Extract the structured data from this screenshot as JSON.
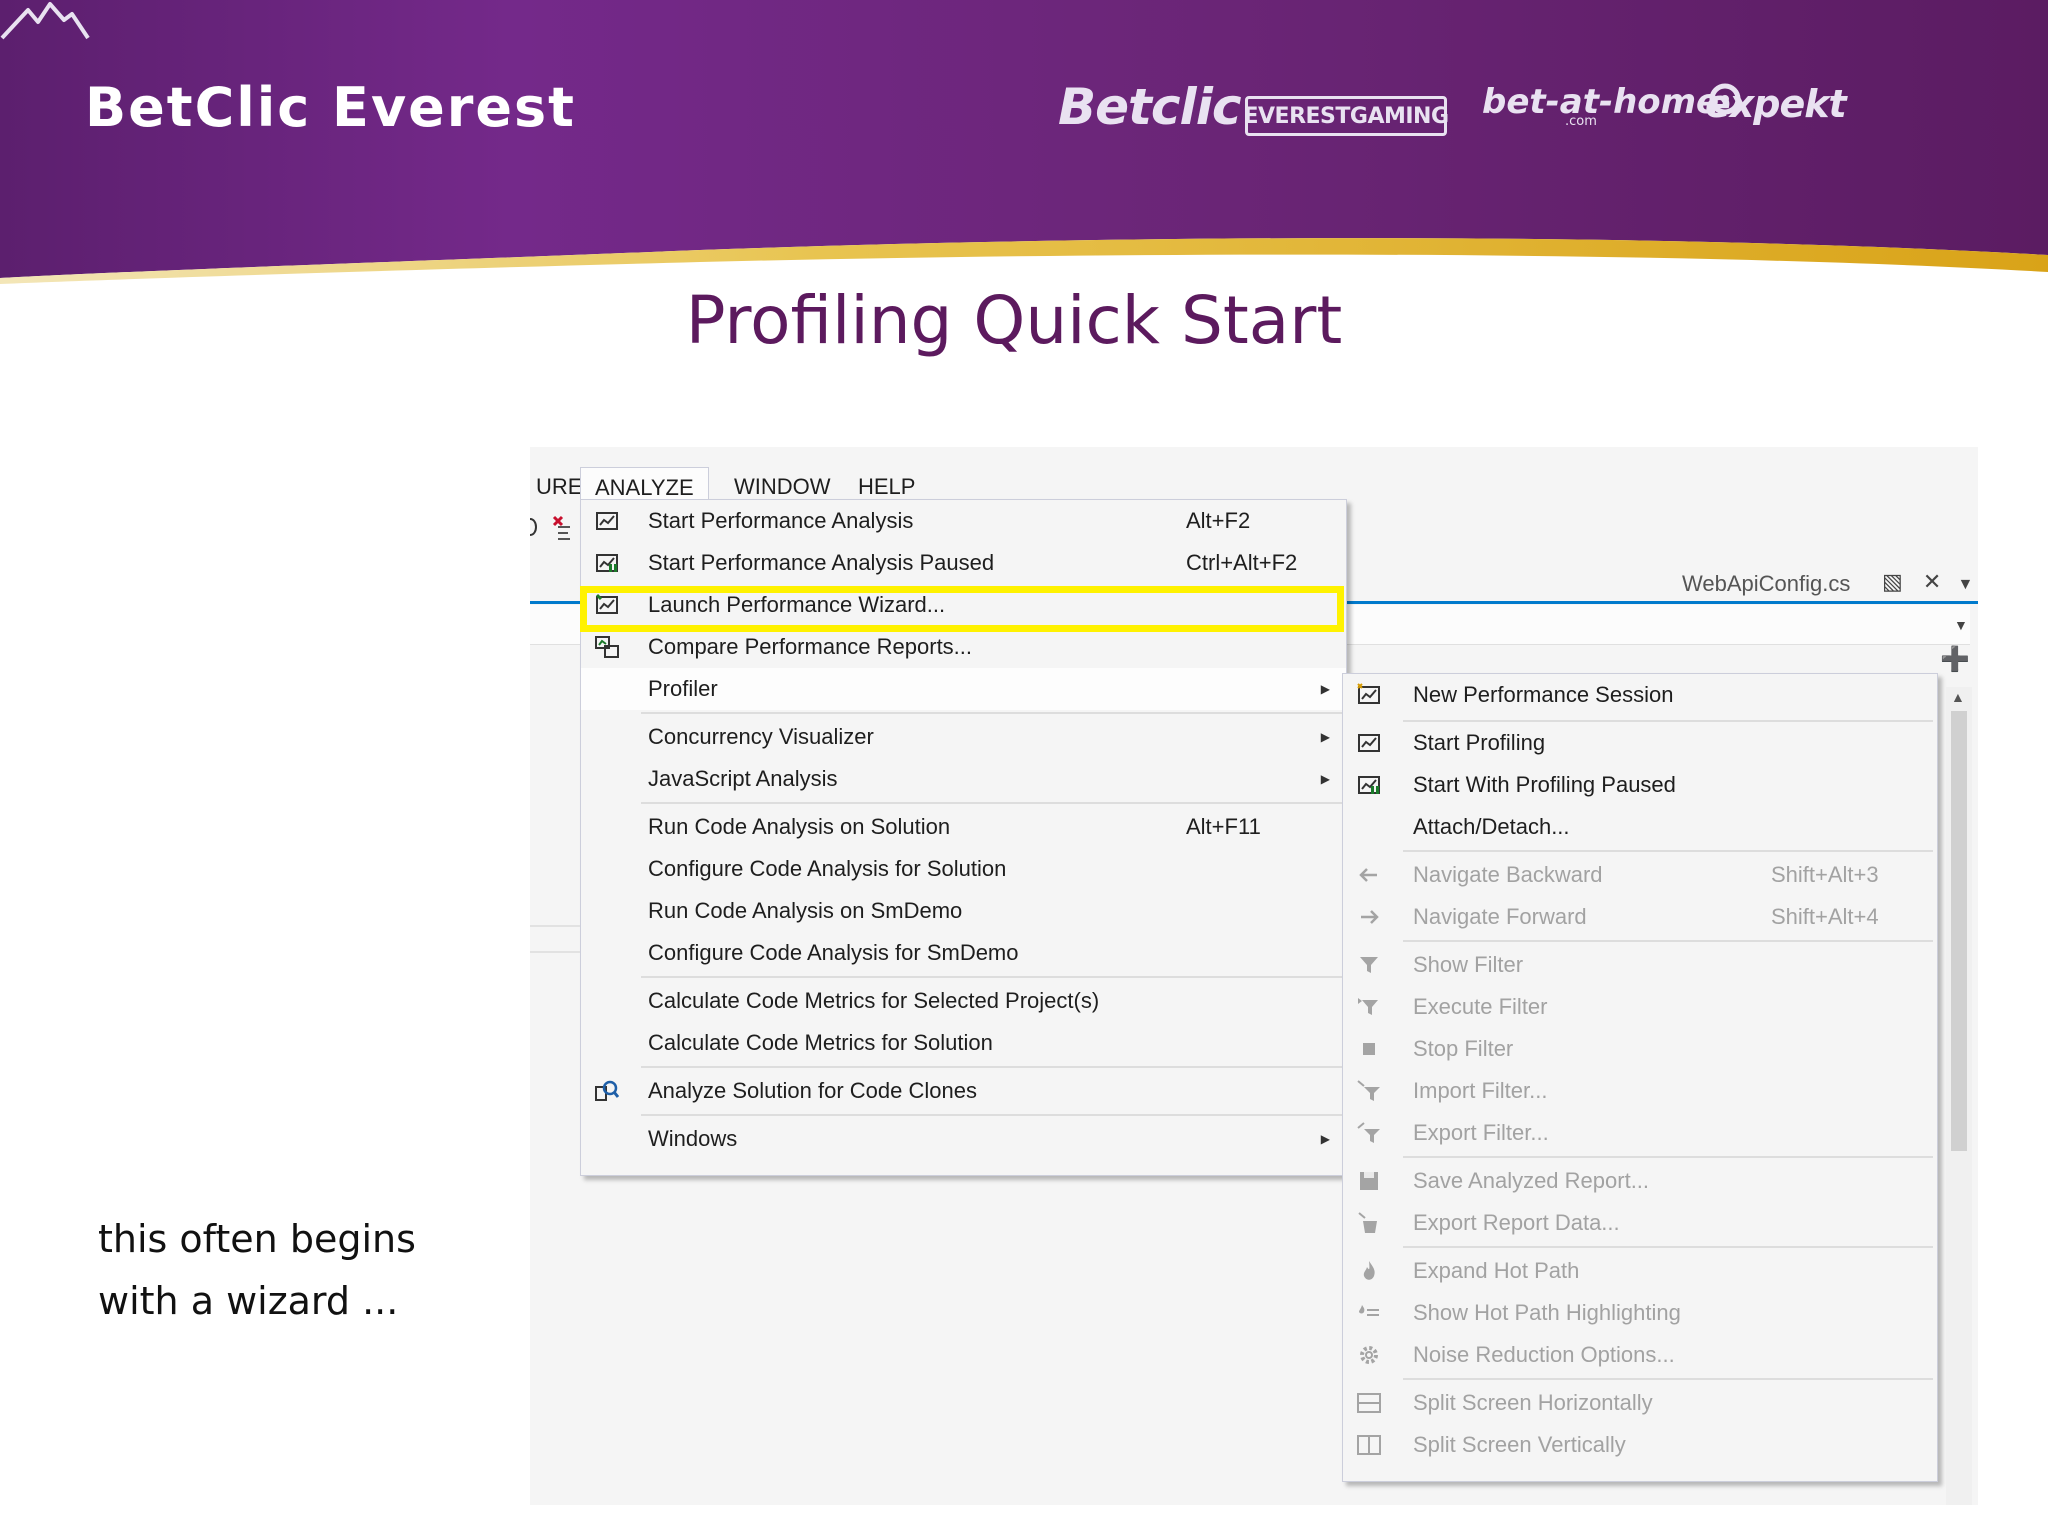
{
  "banner": {
    "title": "BetClic Everest",
    "logos": {
      "betclic": "Betclic",
      "everest_gaming": "EVERESTGAMING",
      "bet_at_home": "bet-at-home",
      "bet_at_home_sub": ".com",
      "expekt": "expekt"
    },
    "colors": {
      "purple": "#6a2576",
      "gold": "#e0b01c"
    }
  },
  "slide": {
    "title": "Profiling Quick Start",
    "caption_line1": "this often begins",
    "caption_line2": "with a wizard ..."
  },
  "ide": {
    "menubar": [
      {
        "label": "URE",
        "active": false
      },
      {
        "label": "ANALYZE",
        "active": true
      },
      {
        "label": "WINDOW",
        "active": false
      },
      {
        "label": "HELP",
        "active": false
      }
    ],
    "document_tab": "WebApiConfig.cs",
    "accent_color": "#007acc"
  },
  "analyze_menu": {
    "items": [
      {
        "label": "Start Performance Analysis",
        "shortcut": "Alt+F2",
        "icon": "performance-icon"
      },
      {
        "label": "Start Performance Analysis Paused",
        "shortcut": "Ctrl+Alt+F2",
        "icon": "performance-paused-icon"
      },
      {
        "label": "Launch Performance Wizard...",
        "shortcut": "",
        "icon": "wizard-icon",
        "highlighted": true
      },
      {
        "label": "Compare Performance Reports...",
        "shortcut": "",
        "icon": "compare-reports-icon"
      },
      {
        "label": "Profiler",
        "shortcut": "",
        "submenu": true
      },
      {
        "label": "Concurrency Visualizer",
        "shortcut": "",
        "submenu": true
      },
      {
        "label": "JavaScript Analysis",
        "shortcut": "",
        "submenu": true
      },
      {
        "label": "Run Code Analysis on Solution",
        "shortcut": "Alt+F11"
      },
      {
        "label": "Configure Code Analysis for Solution",
        "shortcut": ""
      },
      {
        "label": "Run Code Analysis on SmDemo",
        "shortcut": ""
      },
      {
        "label": "Configure Code Analysis for SmDemo",
        "shortcut": ""
      },
      {
        "label": "Calculate Code Metrics for Selected Project(s)",
        "shortcut": ""
      },
      {
        "label": "Calculate Code Metrics for Solution",
        "shortcut": ""
      },
      {
        "label": "Analyze Solution for Code Clones",
        "shortcut": "",
        "icon": "code-clones-icon"
      },
      {
        "label": "Windows",
        "shortcut": "",
        "submenu": true
      }
    ],
    "highlight_color": "#fff200"
  },
  "profiler_menu": {
    "items": [
      {
        "label": "New Performance Session",
        "shortcut": "",
        "enabled": true,
        "icon": "new-session-icon"
      },
      {
        "label": "Start Profiling",
        "shortcut": "",
        "enabled": true,
        "icon": "start-profiling-icon"
      },
      {
        "label": "Start With Profiling Paused",
        "shortcut": "",
        "enabled": true,
        "icon": "profiling-paused-icon"
      },
      {
        "label": "Attach/Detach...",
        "shortcut": "",
        "enabled": true
      },
      {
        "label": "Navigate Backward",
        "shortcut": "Shift+Alt+3",
        "enabled": false,
        "icon": "arrow-left-icon"
      },
      {
        "label": "Navigate Forward",
        "shortcut": "Shift+Alt+4",
        "enabled": false,
        "icon": "arrow-right-icon"
      },
      {
        "label": "Show Filter",
        "shortcut": "",
        "enabled": false,
        "icon": "filter-icon"
      },
      {
        "label": "Execute Filter",
        "shortcut": "",
        "enabled": false,
        "icon": "execute-filter-icon"
      },
      {
        "label": "Stop Filter",
        "shortcut": "",
        "enabled": false,
        "icon": "stop-icon"
      },
      {
        "label": "Import Filter...",
        "shortcut": "",
        "enabled": false,
        "icon": "import-filter-icon"
      },
      {
        "label": "Export Filter...",
        "shortcut": "",
        "enabled": false,
        "icon": "export-filter-icon"
      },
      {
        "label": "Save Analyzed Report...",
        "shortcut": "",
        "enabled": false,
        "icon": "save-icon"
      },
      {
        "label": "Export Report Data...",
        "shortcut": "",
        "enabled": false,
        "icon": "export-data-icon"
      },
      {
        "label": "Expand Hot Path",
        "shortcut": "",
        "enabled": false,
        "icon": "flame-icon"
      },
      {
        "label": "Show Hot Path Highlighting",
        "shortcut": "",
        "enabled": false,
        "icon": "hot-path-icon"
      },
      {
        "label": "Noise Reduction Options...",
        "shortcut": "",
        "enabled": false,
        "icon": "gear-icon"
      },
      {
        "label": "Split Screen Horizontally",
        "shortcut": "",
        "enabled": false,
        "icon": "split-horizontal-icon"
      },
      {
        "label": "Split Screen Vertically",
        "shortcut": "",
        "enabled": false,
        "icon": "split-vertical-icon"
      }
    ]
  }
}
